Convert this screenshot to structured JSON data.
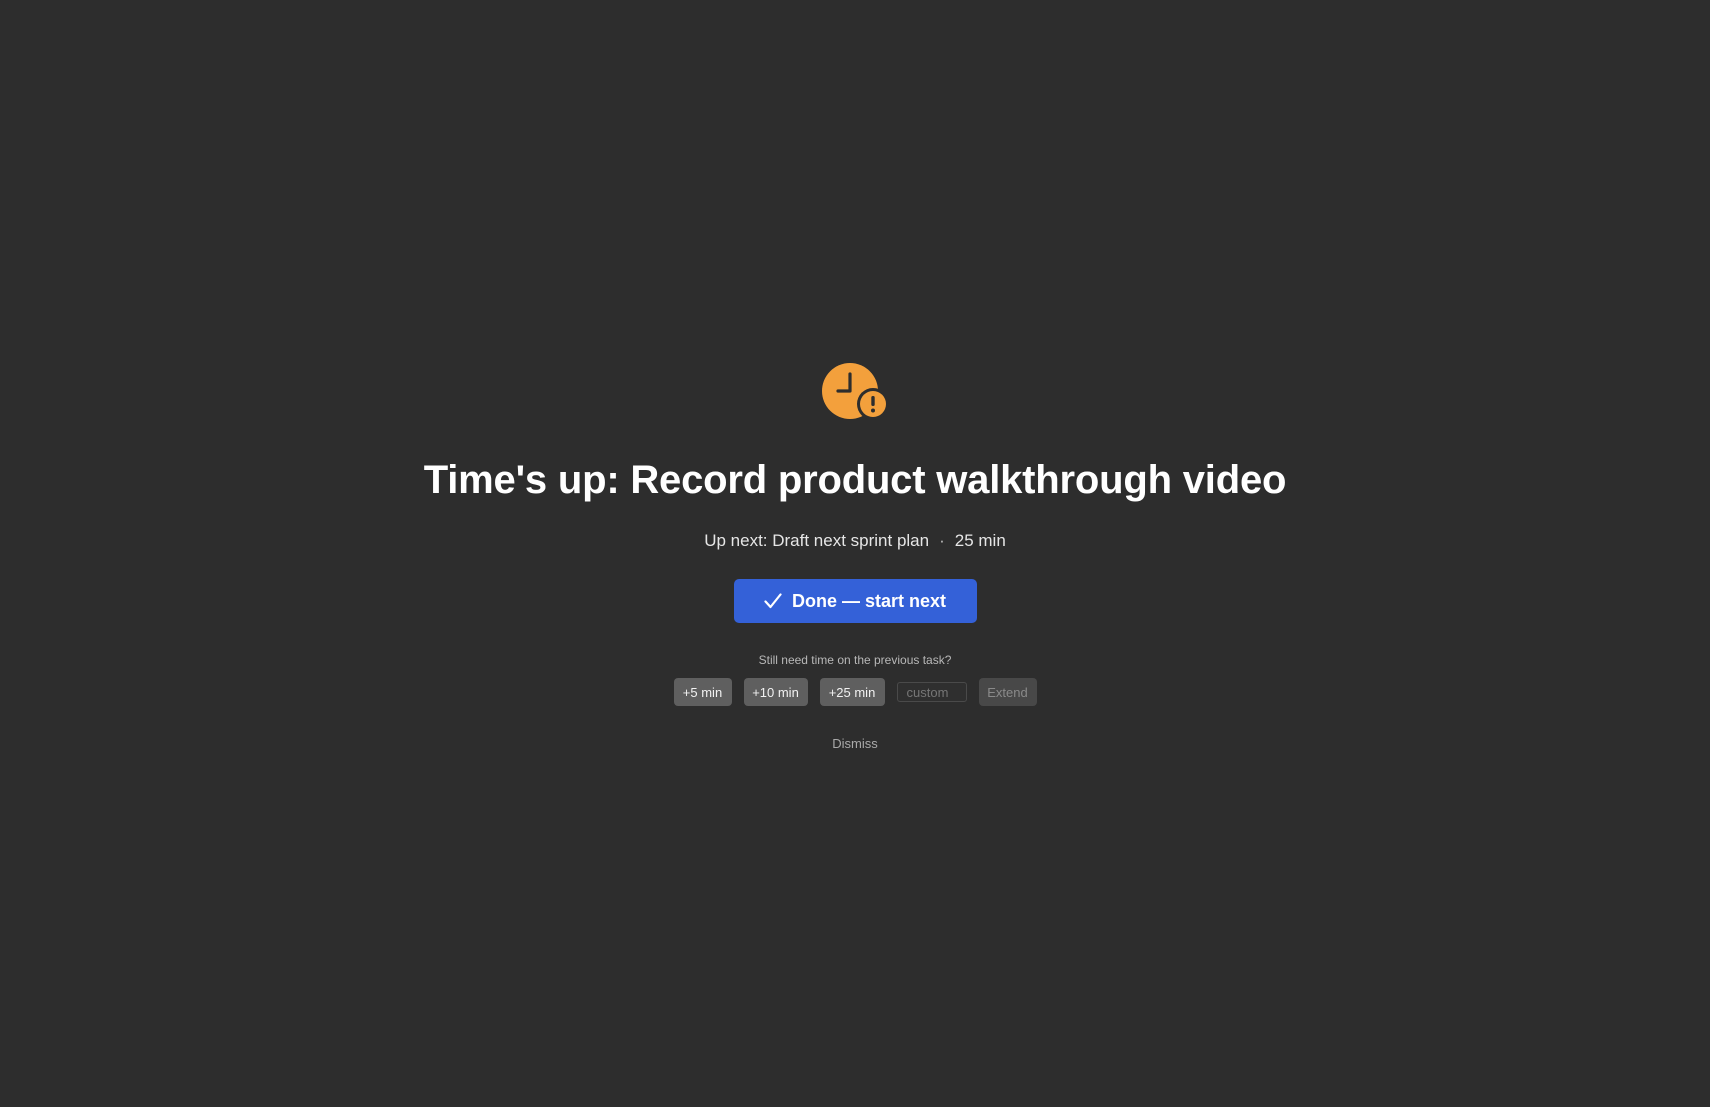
{
  "alert": {
    "icon": "clock-alert-icon",
    "accent_color": "#f3a03c",
    "title": "Time's up: Record product walkthrough video",
    "up_next_label": "Up next: Draft next sprint plan",
    "separator": "·",
    "up_next_duration": "25 min"
  },
  "primary_action": {
    "icon": "checkmark-icon",
    "label": "Done — start next",
    "color": "#3461d8"
  },
  "extend": {
    "prompt": "Still need time on the previous task?",
    "options": [
      "+5 min",
      "+10 min",
      "+25 min"
    ],
    "custom_placeholder": "custom",
    "custom_value": "",
    "submit_label": "Extend"
  },
  "dismiss_label": "Dismiss"
}
